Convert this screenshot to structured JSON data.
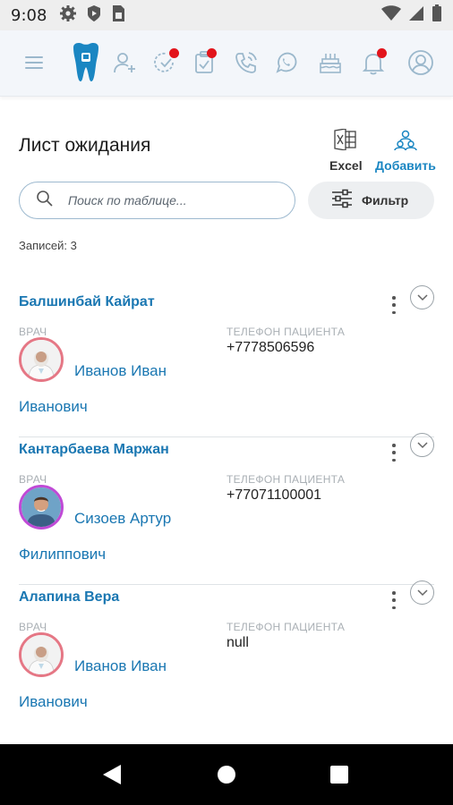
{
  "status_bar": {
    "time": "9:08",
    "left_icons": [
      "gear-icon",
      "shield-play-icon",
      "sim-card-icon"
    ],
    "right_icons": [
      "wifi-icon",
      "signal-icon",
      "battery-icon"
    ]
  },
  "header": {
    "icons": [
      "menu-icon",
      "tooth-logo-icon",
      "add-user-icon",
      "clock-check-icon",
      "clipboard-check-icon",
      "phone-icon",
      "whatsapp-icon",
      "cake-icon",
      "bell-icon",
      "profile-icon"
    ],
    "notification_dot_color": "#e2141b",
    "accent_color": "#1a86c2"
  },
  "page": {
    "title": "Лист ожидания",
    "excel_label": "Excel",
    "add_label": "Добавить",
    "search_placeholder": "Поиск по таблице...",
    "filter_label": "Фильтр",
    "records_count": "Записей: 3"
  },
  "waitlist": [
    {
      "patient": "Балшинбай Кайрат",
      "doctor_label": "ВРАЧ",
      "doctor": "Иванов Иван Иванович",
      "phone_label": "ТЕЛЕФОН ПАЦИЕНТА",
      "phone": "+7778506596",
      "avatar_ring": "#e57785"
    },
    {
      "patient": "Кантарбаева Маржан",
      "doctor_label": "ВРАЧ",
      "doctor": "Сизоев Артур Филиппович",
      "phone_label": "ТЕЛЕФОН ПАЦИЕНТА",
      "phone": "+77071100001",
      "avatar_ring": "#c04ad6"
    },
    {
      "patient": "Алапина Вера",
      "doctor_label": "ВРАЧ",
      "doctor": "Иванов Иван Иванович",
      "phone_label": "ТЕЛЕФОН ПАЦИЕНТА",
      "phone": "null",
      "avatar_ring": "#e57785"
    }
  ]
}
